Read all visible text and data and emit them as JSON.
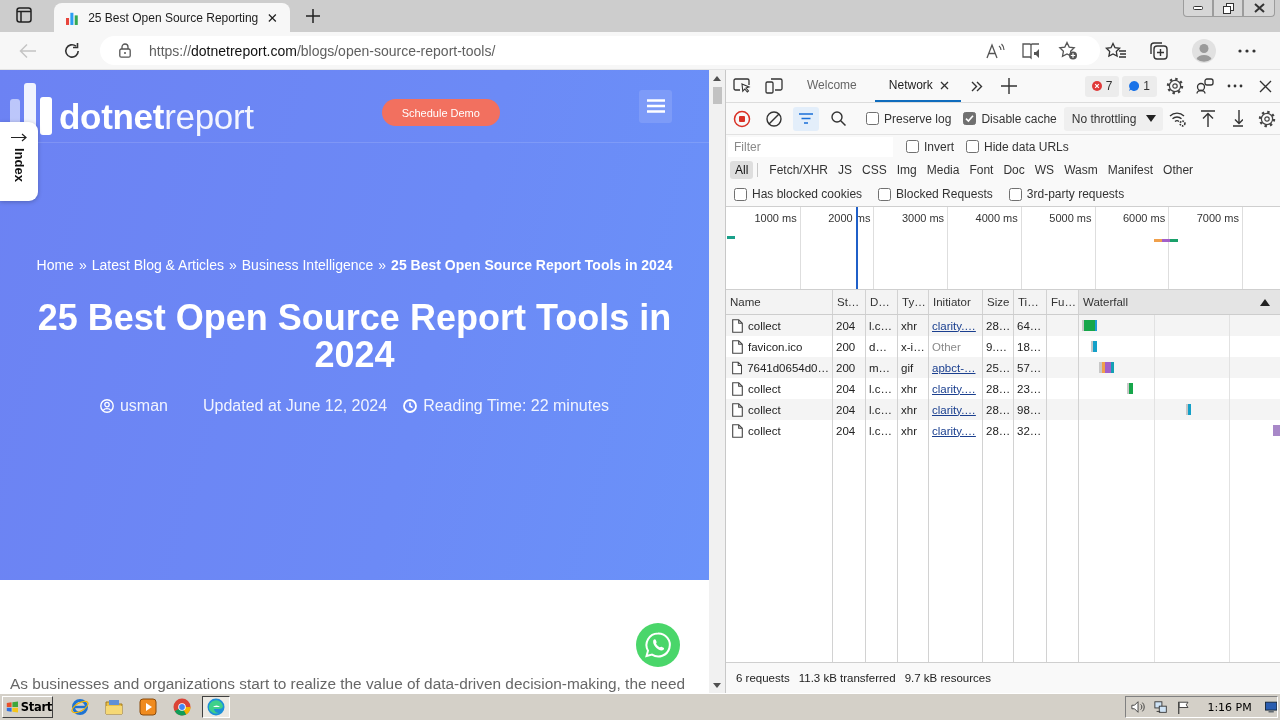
{
  "browser": {
    "tabs": [
      {
        "title": "25 Best Open Source Reporting",
        "selected": true
      }
    ],
    "back_disabled": true,
    "address": {
      "scheme": "https://",
      "domain": "dotnetreport.com",
      "path": "/blogs/open-source-report-tools/"
    }
  },
  "page": {
    "logo": {
      "strong": "dotnet",
      "light": "report"
    },
    "cta": "Schedule Demo",
    "index_tab": "Index",
    "breadcrumb": [
      {
        "kind": "link",
        "label": "Home"
      },
      {
        "kind": "separator",
        "label": "»"
      },
      {
        "kind": "link",
        "label": "Latest Blog & Articles"
      },
      {
        "kind": "separator",
        "label": "»"
      },
      {
        "kind": "link",
        "label": "Business Intelligence"
      },
      {
        "kind": "separator",
        "label": "»"
      },
      {
        "kind": "current",
        "label": "25 Best Open Source Report Tools in 2024"
      }
    ],
    "title": "25 Best Open Source Report Tools in 2024",
    "meta": {
      "author": "usman",
      "updated": "Updated at June 12, 2024",
      "reading_time": "Reading Time: 22 minutes"
    },
    "intro": "As businesses and organizations start to realize the value of data-driven decision-making, the need"
  },
  "devtools": {
    "tabs": [
      {
        "label": "Welcome",
        "selected": false,
        "closable": false
      },
      {
        "label": "Network",
        "selected": true,
        "closable": true
      }
    ],
    "issues": {
      "errors": "7",
      "messages": "1"
    },
    "recording": true,
    "options": [
      {
        "label": "Preserve log",
        "checked": false
      },
      {
        "label": "Disable cache",
        "checked": true
      }
    ],
    "throttling": "No throttling",
    "filter": {
      "placeholder": "Filter"
    },
    "filter_options": [
      {
        "label": "Invert",
        "checked": false
      },
      {
        "label": "Hide data URLs",
        "checked": false
      }
    ],
    "type_filters": [
      {
        "label": "All",
        "selected": true
      },
      {
        "label": "Fetch/XHR",
        "selected": false
      },
      {
        "label": "JS",
        "selected": false
      },
      {
        "label": "CSS",
        "selected": false
      },
      {
        "label": "Img",
        "selected": false
      },
      {
        "label": "Media",
        "selected": false
      },
      {
        "label": "Font",
        "selected": false
      },
      {
        "label": "Doc",
        "selected": false
      },
      {
        "label": "WS",
        "selected": false
      },
      {
        "label": "Wasm",
        "selected": false
      },
      {
        "label": "Manifest",
        "selected": false
      },
      {
        "label": "Other",
        "selected": false
      }
    ],
    "request_filters": [
      {
        "label": "Has blocked cookies",
        "checked": false
      },
      {
        "label": "Blocked Requests",
        "checked": false
      },
      {
        "label": "3rd-party requests",
        "checked": false
      }
    ],
    "overview": {
      "ticks": [
        "1000 ms",
        "2000 ms",
        "3000 ms",
        "4000 ms",
        "5000 ms",
        "6000 ms",
        "7000 ms"
      ]
    },
    "table": {
      "columns": [
        {
          "label": "Name",
          "sorted": false
        },
        {
          "label": "St…",
          "sorted": false
        },
        {
          "label": "D…",
          "sorted": false
        },
        {
          "label": "Ty…",
          "sorted": false
        },
        {
          "label": "Initiator",
          "sorted": false
        },
        {
          "label": "Size",
          "sorted": false
        },
        {
          "label": "Ti…",
          "sorted": false
        },
        {
          "label": "Fu…",
          "sorted": false
        },
        {
          "label": "Waterfall",
          "sorted": true
        }
      ],
      "rows": [
        {
          "name": "collect",
          "status": "204",
          "domain": "l.c…",
          "type": "xhr",
          "initiator": {
            "label": "clarity.…",
            "kind": "link"
          },
          "size": "28…",
          "time": "64…"
        },
        {
          "name": "favicon.ico",
          "status": "200",
          "domain": "d…",
          "type": "x-i…",
          "initiator": {
            "label": "Other",
            "kind": "text"
          },
          "size": "9.…",
          "time": "18…"
        },
        {
          "name": "7641d0654d0…",
          "status": "200",
          "domain": "m…",
          "type": "gif",
          "initiator": {
            "label": "apbct-…",
            "kind": "link"
          },
          "size": "25…",
          "time": "57…"
        },
        {
          "name": "collect",
          "status": "204",
          "domain": "l.c…",
          "type": "xhr",
          "initiator": {
            "label": "clarity.…",
            "kind": "link"
          },
          "size": "28…",
          "time": "23…"
        },
        {
          "name": "collect",
          "status": "204",
          "domain": "l.c…",
          "type": "xhr",
          "initiator": {
            "label": "clarity.…",
            "kind": "link"
          },
          "size": "28…",
          "time": "98…"
        },
        {
          "name": "collect",
          "status": "204",
          "domain": "l.c…",
          "type": "xhr",
          "initiator": {
            "label": "clarity.…",
            "kind": "link"
          },
          "size": "28…",
          "time": "32…"
        }
      ]
    },
    "status_bar": [
      "6 requests",
      "11.3 kB transferred",
      "9.7 kB resources"
    ]
  },
  "taskbar": {
    "start": "Start",
    "apps": [
      {
        "kind": "globe",
        "selected": false
      },
      {
        "kind": "folder",
        "selected": false
      },
      {
        "kind": "player",
        "selected": false
      },
      {
        "kind": "ball",
        "selected": false
      },
      {
        "kind": "swirl",
        "selected": true
      }
    ],
    "clock": "1:16 PM"
  }
}
